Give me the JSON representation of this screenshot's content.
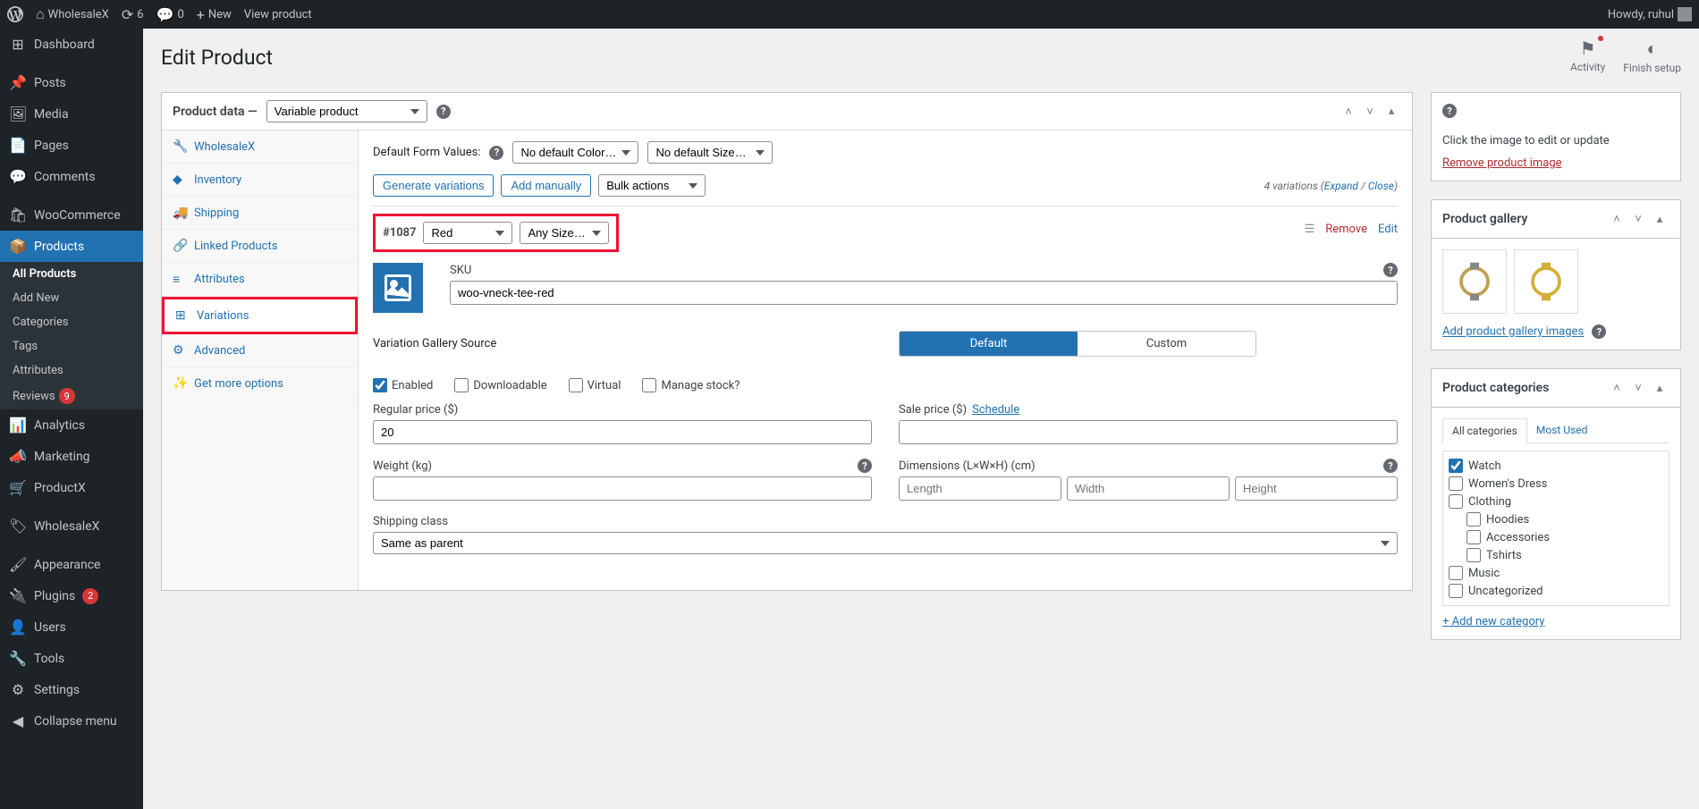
{
  "admin_bar": {
    "site_name": "WholesaleX",
    "updates": "6",
    "comments": "0",
    "new_label": "New",
    "view_product": "View product",
    "howdy": "Howdy, ruhul"
  },
  "sidebar": {
    "dashboard": "Dashboard",
    "posts": "Posts",
    "media": "Media",
    "pages": "Pages",
    "comments": "Comments",
    "woocommerce": "WooCommerce",
    "products": "Products",
    "products_sub": {
      "all": "All Products",
      "add_new": "Add New",
      "categories": "Categories",
      "tags": "Tags",
      "attributes": "Attributes",
      "reviews": "Reviews",
      "reviews_count": "9"
    },
    "analytics": "Analytics",
    "marketing": "Marketing",
    "productx": "ProductX",
    "wholesalex": "WholesaleX",
    "appearance": "Appearance",
    "plugins": "Plugins",
    "plugins_count": "2",
    "users": "Users",
    "tools": "Tools",
    "settings": "Settings",
    "collapse": "Collapse menu"
  },
  "header": {
    "title": "Edit Product",
    "activity": "Activity",
    "finish_setup": "Finish setup"
  },
  "product_data": {
    "label": "Product data —",
    "type": "Variable product",
    "tabs": {
      "wholesalex": "WholesaleX",
      "inventory": "Inventory",
      "shipping": "Shipping",
      "linked": "Linked Products",
      "attributes": "Attributes",
      "variations": "Variations",
      "advanced": "Advanced",
      "more": "Get more options"
    }
  },
  "variations": {
    "default_form_label": "Default Form Values:",
    "default_color": "No default Color…",
    "default_size": "No default Size…",
    "generate_btn": "Generate variations",
    "add_manually": "Add manually",
    "bulk_actions": "Bulk actions",
    "count_text": "4 variations",
    "expand": "Expand",
    "close": "Close",
    "variation_id": "#1087",
    "sel_color": "Red",
    "sel_size": "Any Size…",
    "remove": "Remove",
    "edit": "Edit"
  },
  "variation_detail": {
    "sku_label": "SKU",
    "sku_value": "woo-vneck-tee-red",
    "gallery_source_label": "Variation Gallery Source",
    "toggle_default": "Default",
    "toggle_custom": "Custom",
    "enabled": "Enabled",
    "downloadable": "Downloadable",
    "virtual": "Virtual",
    "manage_stock": "Manage stock?",
    "regular_price": "Regular price ($)",
    "regular_price_value": "20",
    "sale_price": "Sale price ($)",
    "schedule": "Schedule",
    "weight": "Weight (kg)",
    "dimensions": "Dimensions (L×W×H) (cm)",
    "length_ph": "Length",
    "width_ph": "Width",
    "height_ph": "Height",
    "shipping_class": "Shipping class",
    "shipping_value": "Same as parent"
  },
  "side_image": {
    "click_text": "Click the image to edit or update",
    "remove": "Remove product image"
  },
  "side_gallery": {
    "title": "Product gallery",
    "add_link": "Add product gallery images"
  },
  "side_categories": {
    "title": "Product categories",
    "tab_all": "All categories",
    "tab_most": "Most Used",
    "cats": {
      "watch": "Watch",
      "womens_dress": "Women's Dress",
      "clothing": "Clothing",
      "hoodies": "Hoodies",
      "accessories": "Accessories",
      "tshirts": "Tshirts",
      "music": "Music",
      "uncategorized": "Uncategorized"
    },
    "add_new": "+ Add new category"
  }
}
